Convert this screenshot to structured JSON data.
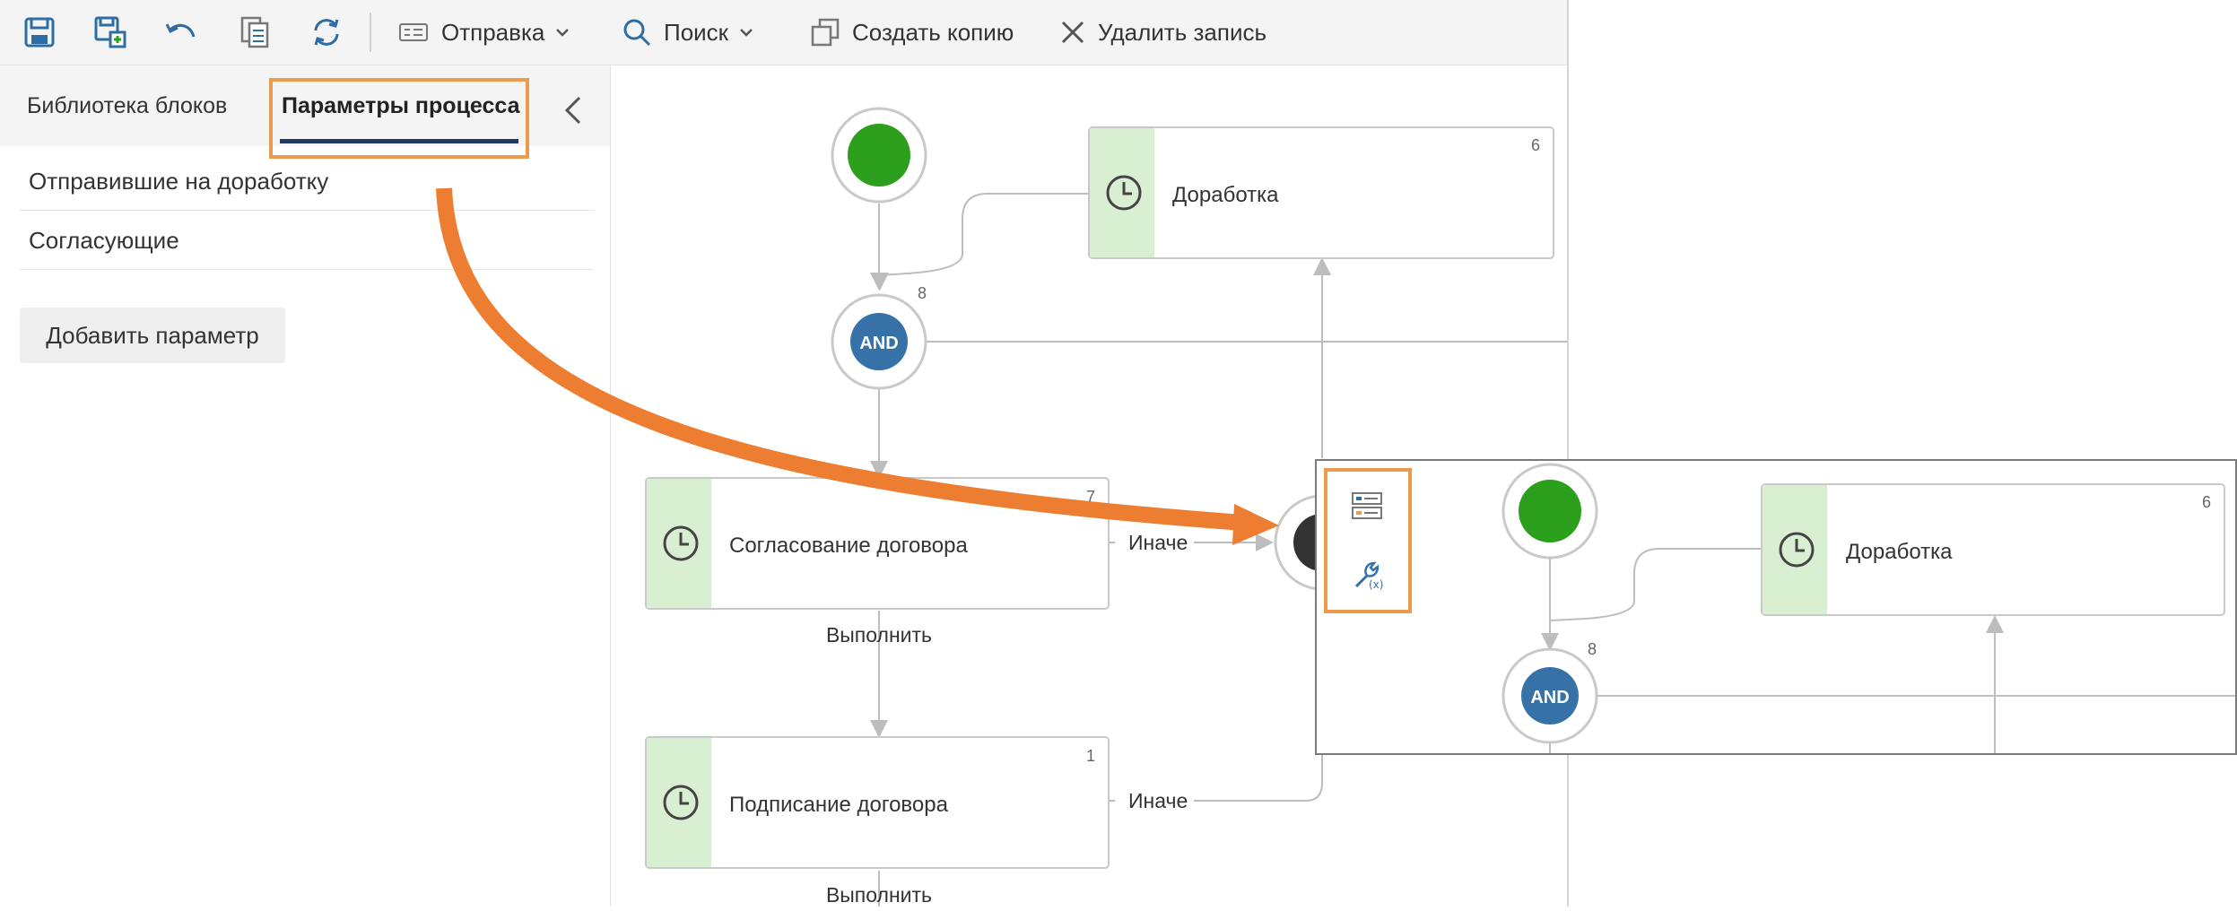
{
  "toolbar": {
    "save_icon": "save-icon",
    "save_as_icon": "save-as-icon",
    "undo_icon": "undo-icon",
    "copy_icon": "copy-icon",
    "refresh_icon": "refresh-icon",
    "send_label": "Отправка",
    "search_label": "Поиск",
    "create_copy_label": "Создать копию",
    "delete_label": "Удалить запись"
  },
  "sidebar": {
    "tabs": [
      {
        "label": "Библиотека блоков",
        "active": false
      },
      {
        "label": "Параметры процесса",
        "active": true
      }
    ],
    "params": [
      {
        "label": "Отправившие на доработку"
      },
      {
        "label": "Согласующие"
      }
    ],
    "add_param_label": "Добавить параметр"
  },
  "diagram": {
    "tasks": [
      {
        "label": "Доработка",
        "number": "6"
      },
      {
        "label": "Согласование договора",
        "number": "7"
      },
      {
        "label": "Подписание договора",
        "number": "1"
      }
    ],
    "and_gateway": {
      "label": "AND",
      "number": "8"
    },
    "edge_labels": {
      "otherwise": "Иначе",
      "execute": "Выполнить"
    }
  },
  "inset": {
    "task": {
      "label": "Доработка",
      "number": "6"
    },
    "and_gateway": {
      "label": "AND",
      "number": "8"
    }
  },
  "colors": {
    "highlight": "#ec9a4e",
    "arrow": "#ed7d31",
    "start_green": "#2ca01c",
    "and_blue": "#3672a8",
    "task_accent": "#d9efd2",
    "tab_underline": "#1d3b66"
  }
}
